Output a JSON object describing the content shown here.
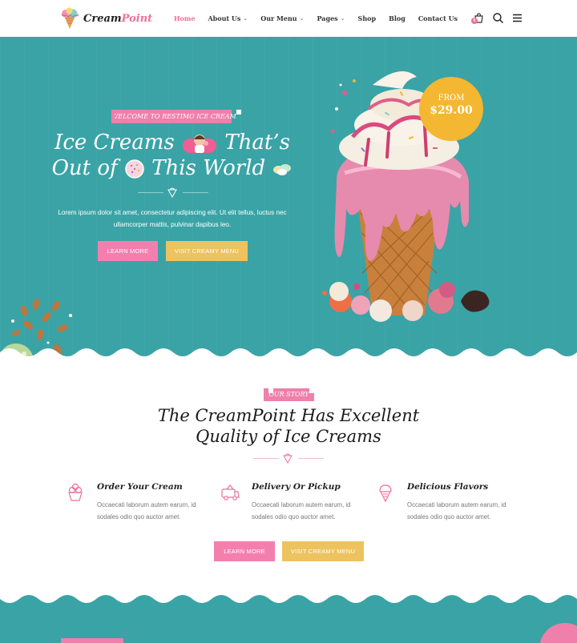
{
  "header": {
    "logo": {
      "part1": "Cream",
      "part2": "Point"
    },
    "nav": [
      {
        "label": "Home",
        "dropdown": false,
        "active": true
      },
      {
        "label": "About Us",
        "dropdown": true,
        "active": false
      },
      {
        "label": "Our Menu",
        "dropdown": true,
        "active": false
      },
      {
        "label": "Pages",
        "dropdown": true,
        "active": false
      },
      {
        "label": "Shop",
        "dropdown": false,
        "active": false
      },
      {
        "label": "Blog",
        "dropdown": false,
        "active": false
      },
      {
        "label": "Contact Us",
        "dropdown": false,
        "active": false
      }
    ],
    "cart_count": "0",
    "icons": [
      "cart-icon",
      "search-icon",
      "menu-icon"
    ]
  },
  "hero": {
    "ribbon": "WELCOME TO RESTIMO ICE CREAM",
    "title_line1_a": "Ice Creams",
    "title_line1_b": "That’s",
    "title_line2_a": "Out of",
    "title_line2_b": "This World",
    "description": "Lorem ipsum dolor sit amet, consectetur adipiscing elit. Ut elit tellus, luctus nec ullamcorper mattis, pulvinar dapibus leo.",
    "btn_primary": "LEARN MORE",
    "btn_secondary": "VISIT CREAMY MENU",
    "price_from": "FROM",
    "price_value": "$29.00"
  },
  "story": {
    "ribbon": "OUR STORY",
    "title_line1": "The CreamPoint Has Excellent",
    "title_line2": "Quality of Ice Creams",
    "features": [
      {
        "title": "Order Your Cream",
        "text": "Occaecati laborum autem earum, id sodales odio quo auctor amet.",
        "icon": "ice-cream-cup-icon"
      },
      {
        "title": "Delivery Or Pickup",
        "text": "Occaecati laborum autem earum, id sodales odio quo auctor amet.",
        "icon": "ice-cream-truck-icon"
      },
      {
        "title": "Delicious Flavors",
        "text": "Occaecati laborum autem earum, id sodales odio quo auctor amet.",
        "icon": "ice-cream-cone-icon"
      }
    ],
    "btn_primary": "LEARN MORE",
    "btn_secondary": "VISIT CREAMY MENU"
  },
  "colors": {
    "teal": "#3aa3a6",
    "pink": "#ef7fab",
    "gold": "#ecc35f",
    "badge": "#f4b731"
  }
}
